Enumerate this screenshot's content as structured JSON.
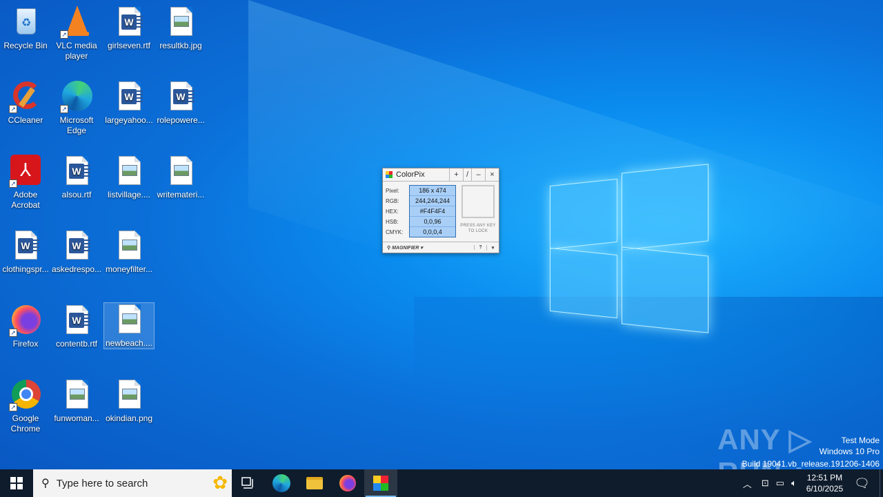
{
  "desktop": {
    "icons": [
      {
        "label": "Recycle Bin"
      },
      {
        "label": "VLC media player"
      },
      {
        "label": "girlseven.rtf"
      },
      {
        "label": "resultkb.jpg"
      },
      {
        "label": "CCleaner"
      },
      {
        "label": "Microsoft Edge"
      },
      {
        "label": "largeyahoo..."
      },
      {
        "label": "rolepowere..."
      },
      {
        "label": "Adobe Acrobat"
      },
      {
        "label": "alsou.rtf"
      },
      {
        "label": "listvillage...."
      },
      {
        "label": "writemateri..."
      },
      {
        "label": "clothingspr..."
      },
      {
        "label": "askedrespo..."
      },
      {
        "label": "moneyfilter..."
      },
      {
        "label": "Firefox"
      },
      {
        "label": "contentb.rtf"
      },
      {
        "label": "newbeach...."
      },
      {
        "label": "Google Chrome"
      },
      {
        "label": "funwoman..."
      },
      {
        "label": "okindian.png"
      }
    ]
  },
  "colorpix": {
    "title": "ColorPix",
    "buttons": {
      "pin": "+",
      "slash": "/",
      "minimize": "–",
      "close": "×"
    },
    "labels": {
      "pixel": "Pixel:",
      "rgb": "RGB:",
      "hex": "HEX:",
      "hsb": "HSB:",
      "cmyk": "CMYK:"
    },
    "values": {
      "pixel": "186 x 474",
      "rgb": "244,244,244",
      "hex": "#F4F4F4",
      "hsb": "0,0,96",
      "cmyk": "0,0,0,4"
    },
    "swatch_color": "#F4F4F4",
    "lock_text": "PRESS ANY KEY TO LOCK",
    "magnifier": "MAGNIFIER ▾",
    "help": "?",
    "menu": "▾"
  },
  "watermark": {
    "brand": "ANY ▷ RUN",
    "mode": "Test Mode",
    "os": "Windows 10 Pro",
    "build": "Build 19041.vb_release.191206-1406"
  },
  "taskbar": {
    "search_placeholder": "Type here to search",
    "clock_time": "12:51 PM",
    "clock_date": "6/10/2025"
  }
}
